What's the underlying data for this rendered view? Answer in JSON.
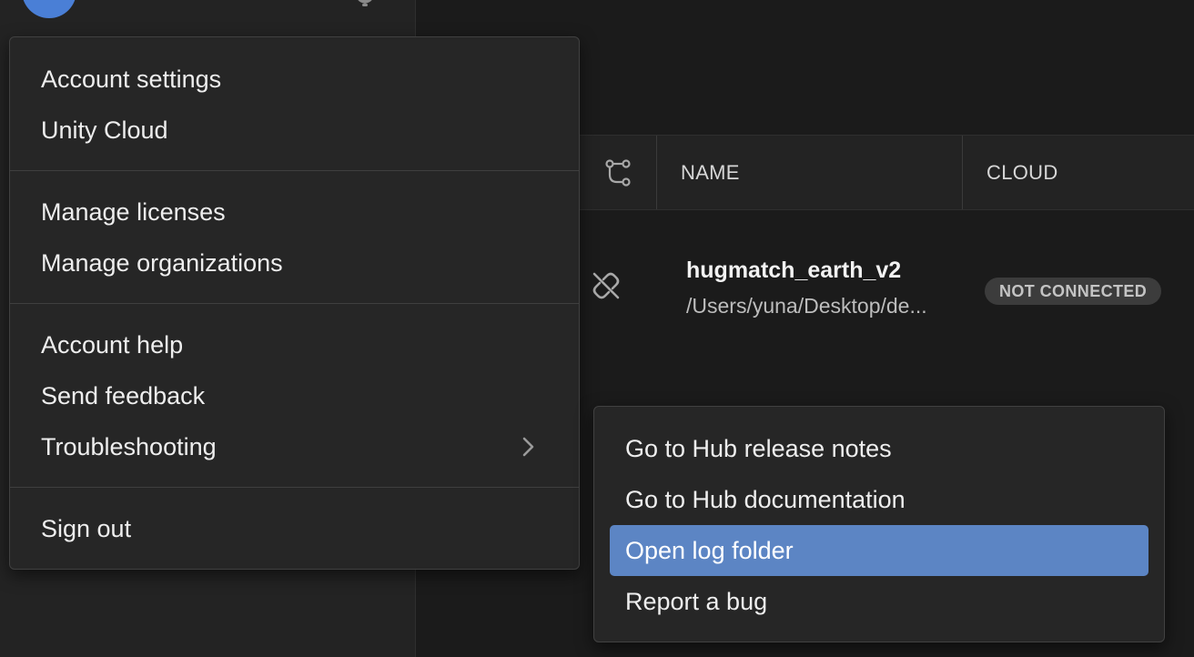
{
  "theme": {
    "accent": "#5c85c4",
    "avatar_color": "#4a7fd6",
    "background": "#1b1b1b",
    "panel": "#232323",
    "menu_bg": "#262626"
  },
  "sidebar": {
    "avatar_icon": "user-avatar",
    "bell_icon": "bell-icon"
  },
  "table": {
    "columns": {
      "version_control_icon": "version-control-icon",
      "name": "NAME",
      "cloud": "CLOUD"
    },
    "rows": [
      {
        "icon": "unlink-icon",
        "name": "hugmatch_earth_v2",
        "path": "/Users/yuna/Desktop/de...",
        "status": "NOT CONNECTED"
      }
    ]
  },
  "account_menu": {
    "sections": [
      {
        "items": [
          {
            "label": "Account settings"
          },
          {
            "label": "Unity Cloud"
          }
        ]
      },
      {
        "items": [
          {
            "label": "Manage licenses"
          },
          {
            "label": "Manage organizations"
          }
        ]
      },
      {
        "items": [
          {
            "label": "Account help"
          },
          {
            "label": "Send feedback"
          },
          {
            "label": "Troubleshooting",
            "submenu_icon": "chevron-right-icon"
          }
        ]
      },
      {
        "items": [
          {
            "label": "Sign out"
          }
        ]
      }
    ]
  },
  "troubleshooting_menu": {
    "items": [
      {
        "label": "Go to Hub release notes",
        "active": false
      },
      {
        "label": "Go to Hub documentation",
        "active": false
      },
      {
        "label": "Open log folder",
        "active": true
      },
      {
        "label": "Report a bug",
        "active": false
      }
    ]
  }
}
